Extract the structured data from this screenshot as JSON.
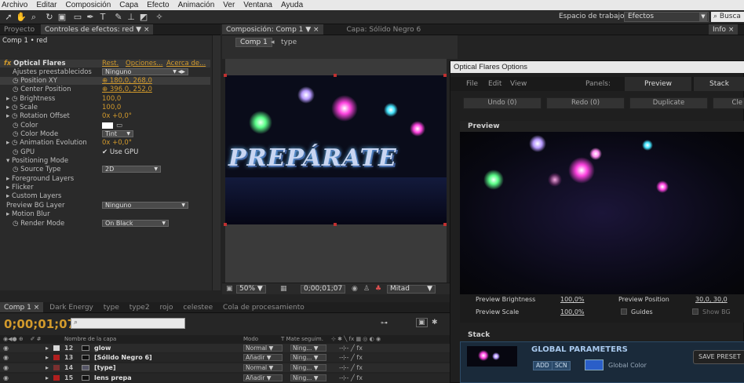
{
  "menubar": [
    "Archivo",
    "Editar",
    "Composición",
    "Capa",
    "Efecto",
    "Animación",
    "Ver",
    "Ventana",
    "Ayuda"
  ],
  "workspace": {
    "label": "Espacio de trabajo:",
    "value": "Efectos",
    "search_placeholder": "Busca"
  },
  "left_tabs": {
    "project": "Proyecto",
    "effect_controls": "Controles de efectos: red"
  },
  "ec_breadcrumb": "Comp 1 • red",
  "effect": {
    "name": "Optical Flares",
    "reset": "Rest.",
    "options": "Opciones...",
    "about": "Acerca de...",
    "presets_label": "Ajustes preestablecidos",
    "presets_value": "Ninguno",
    "props": [
      {
        "label": "Position XY",
        "value": "180,0, 268,0"
      },
      {
        "label": "Center Position",
        "value": "396,0, 252,0"
      },
      {
        "label": "Brightness",
        "value": "100,0"
      },
      {
        "label": "Scale",
        "value": "100,0"
      },
      {
        "label": "Rotation Offset",
        "value": "0x +0,0°"
      },
      {
        "label": "Color",
        "value": ""
      },
      {
        "label": "Color Mode",
        "value": "Tint"
      },
      {
        "label": "Animation Evolution",
        "value": "0x +0,0°"
      },
      {
        "label": "GPU",
        "value": "Use GPU"
      },
      {
        "label": "Positioning Mode",
        "value": ""
      },
      {
        "label": "Source Type",
        "value": "2D"
      },
      {
        "label": "Foreground Layers",
        "value": ""
      },
      {
        "label": "Flicker",
        "value": ""
      },
      {
        "label": "Custom Layers",
        "value": ""
      },
      {
        "label": "Preview BG Layer",
        "value": "Ninguno"
      },
      {
        "label": "Motion Blur",
        "value": ""
      },
      {
        "label": "Render Mode",
        "value": "On Black"
      }
    ]
  },
  "comp_tabs": {
    "composition": "Composición: Comp 1",
    "layer": "Capa: Sólido Negro 6"
  },
  "comp_breadcrumb": {
    "comp": "Comp 1",
    "layer": "type"
  },
  "viewer": {
    "title_text": "PREPÁRATE"
  },
  "comp_bottom": {
    "zoom": "50%",
    "timecode": "0;00;01;07",
    "resolution": "Mitad"
  },
  "right_tabs": {
    "info": "Info"
  },
  "optical_flares": {
    "title": "Optical Flares Options",
    "menu": [
      "File",
      "Edit",
      "View"
    ],
    "panels_label": "Panels:",
    "panel_tabs": [
      "Preview",
      "Stack"
    ],
    "buttons": [
      "Undo (0)",
      "Redo (0)",
      "Duplicate",
      "Cle"
    ],
    "preview_title": "Preview",
    "preview_brightness_label": "Preview Brightness",
    "preview_brightness": "100,0%",
    "preview_position_label": "Preview Position",
    "preview_position": "30,0, 30,0",
    "preview_scale_label": "Preview Scale",
    "preview_scale": "100,0%",
    "guides": "Guides",
    "show_bg": "Show BG",
    "stack_title": "Stack",
    "global_params": "GLOBAL PARAMETERS",
    "add": "ADD",
    "scn": "SCN",
    "global_color": "Global Color",
    "save_preset": "SAVE PRESET"
  },
  "timeline": {
    "tabs": [
      "Comp 1",
      "Dark Energy",
      "type",
      "type2",
      "rojo",
      "celestee",
      "Cola de procesamiento"
    ],
    "timecode": "0;00;01;07",
    "headers": {
      "layer_name": "Nombre de la capa",
      "mode": "Modo",
      "trkmat": "T  Mate seguim."
    },
    "rows": [
      {
        "num": "12",
        "name": "glow",
        "mode": "Normal",
        "mat": "Ning..."
      },
      {
        "num": "13",
        "name": "[Sólido Negro 6]",
        "mode": "Añadir",
        "mat": "Ning..."
      },
      {
        "num": "14",
        "name": "[type]",
        "mode": "Normal",
        "mat": "Ning..."
      },
      {
        "num": "15",
        "name": "lens prepa",
        "mode": "Añadir",
        "mat": "Ning..."
      }
    ]
  },
  "colors": {
    "accent_orange": "#d29a2c",
    "flare_magenta": "#ff33dd",
    "flare_cyan": "#33ccff",
    "flare_green": "#66ff99"
  }
}
